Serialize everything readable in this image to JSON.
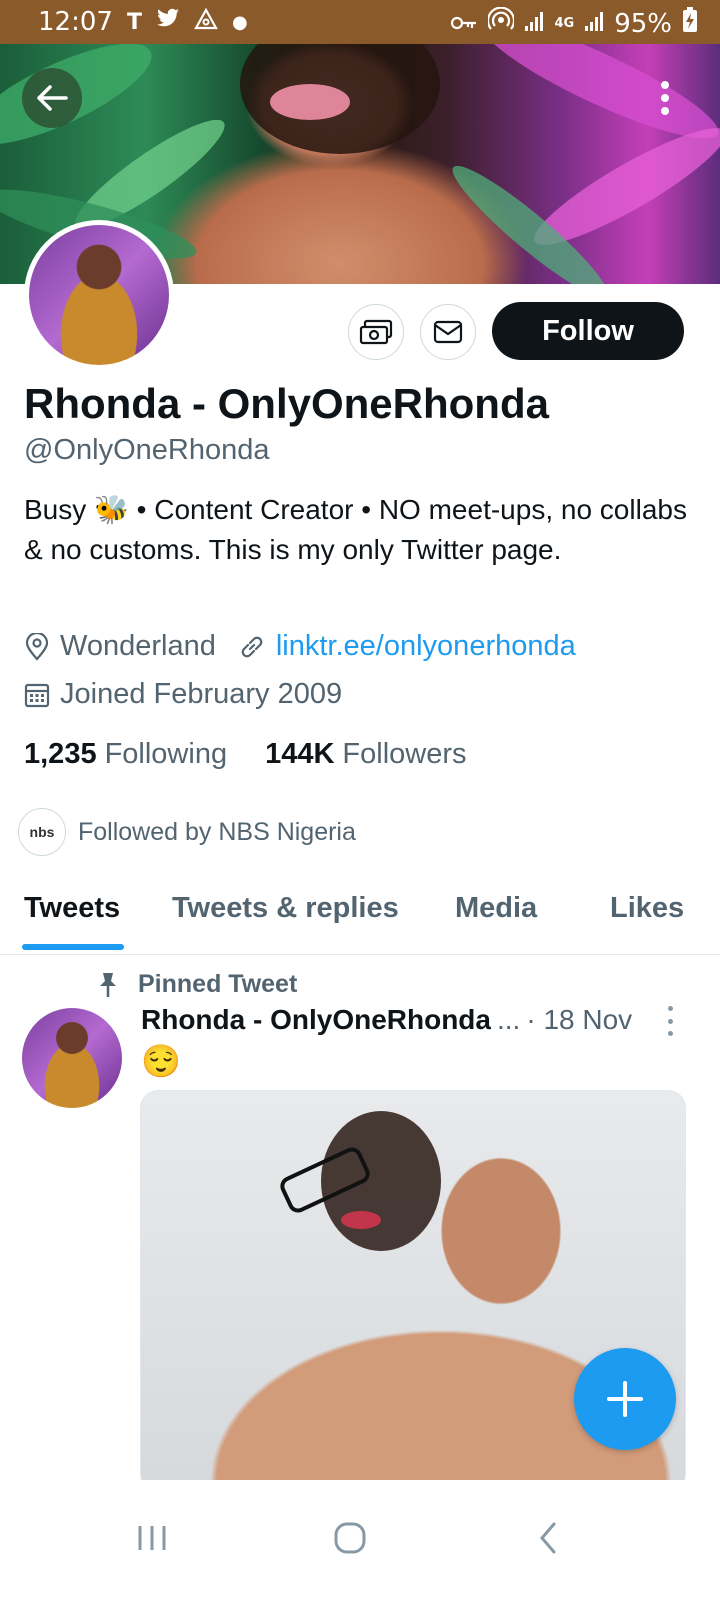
{
  "status_bar": {
    "time": "12:07",
    "left_icons": [
      "T",
      "twitter-bird",
      "triangle-icon",
      "dot"
    ],
    "right_icons": [
      "key-icon",
      "hotspot-icon",
      "signal-icon",
      "4g-icon",
      "signal-icon"
    ],
    "network": "4G",
    "battery": "95%"
  },
  "profile": {
    "name": "Rhonda - OnlyOneRhonda",
    "handle": "@OnlyOneRhonda",
    "bio": "Busy 🐝 • Content Creator • NO meet-ups, no collabs & no customs. This is my only Twitter page.",
    "location": "Wonderland",
    "link": "linktr.ee/onlyonerhonda",
    "joined": "Joined February 2009",
    "following_count": "1,235",
    "following_label": "Following",
    "followers_count": "144K",
    "followers_label": "Followers",
    "followed_by": "Followed by NBS Nigeria",
    "followed_by_icon_text": "nbs"
  },
  "actions": {
    "follow_label": "Follow"
  },
  "tabs": [
    {
      "label": "Tweets",
      "active": true
    },
    {
      "label": "Tweets & replies",
      "active": false
    },
    {
      "label": "Media",
      "active": false
    },
    {
      "label": "Likes",
      "active": false
    }
  ],
  "pinned_tweet": {
    "pinned_label": "Pinned Tweet",
    "author": "Rhonda - OnlyOneRhonda",
    "ellipsis": "...",
    "time": "· 18 Nov",
    "text": "😌"
  },
  "colors": {
    "accent": "#1d9bf0",
    "status_bar": "#8b5a2b",
    "text_primary": "#0f1419",
    "text_secondary": "#536471"
  }
}
